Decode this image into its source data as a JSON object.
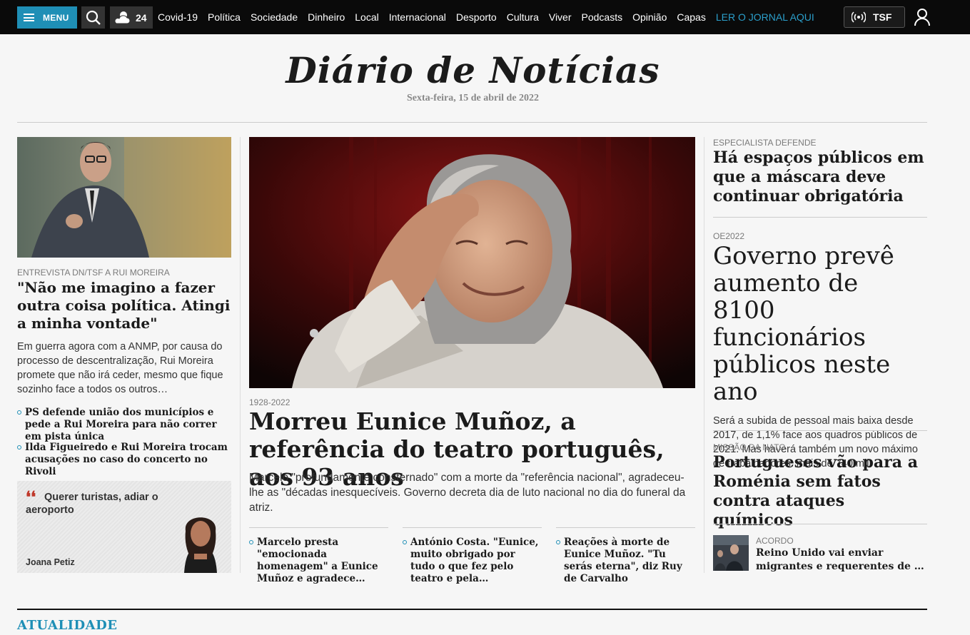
{
  "topbar": {
    "menu_label": "MENU",
    "weather_temp": "24",
    "nav": [
      "Covid-19",
      "Política",
      "Sociedade",
      "Dinheiro",
      "Local",
      "Internacional",
      "Desporto",
      "Cultura",
      "Viver",
      "Podcasts",
      "Opinião",
      "Capas"
    ],
    "read_paper": "LER O JORNAL AQUI",
    "radio_label": "TSF",
    "accent_color": "#1f8fb6"
  },
  "masthead": {
    "logo": "Diário de Notícias",
    "date": "Sexta-feira, 15 de abril de 2022"
  },
  "left": {
    "kicker": "ENTREVISTA DN/TSF A RUI MOREIRA",
    "title": "\"Não me imagino a fazer outra coisa política. Atingi a minha vontade\"",
    "lead": "Em guerra agora com a ANMP, por causa do processo de descentralização, Rui Moreira promete que não irá ceder, mesmo que fique sozinho face a todos os outros…",
    "links": [
      "PS defende união dos municípios e pede a Rui Moreira para não correr em pista única",
      "Ilda Figueiredo e Rui Moreira trocam acusações no caso do concerto no Rivoli"
    ],
    "opinion": {
      "title": "Querer turistas, adiar o aeroporto",
      "author": "Joana Petiz"
    }
  },
  "center": {
    "kicker": "1928-2022",
    "title": "Morreu Eunice Muñoz, a referência do teatro português, aos 93 anos",
    "lead": "Marcelo \"profundamente consternado\" com a morte da \"referência nacional\", agradeceu-lhe as \"décadas inesquecíveis. Governo decreta dia de luto nacional no dia do funeral da atriz.",
    "related": [
      "Marcelo presta \"emocionada homenagem\" a Eunice Muñoz e agradece…",
      "António Costa. \"Eunice, muito obrigado por tudo o que fez pelo teatro e pela…",
      "Reações à morte de Eunice Muñoz. \"Tu serás eterna\", diz Ruy de Carvalho"
    ]
  },
  "right": {
    "s1_kicker": "ESPECIALISTA DEFENDE",
    "s1_title": "Há espaços públicos em que a máscara deve continuar obrigatória",
    "s2_kicker": "OE2022",
    "s2_title": "Governo prevê aumento de 8100 funcionários públicos neste ano",
    "s2_lead": "Será a subida de pessoal mais baixa desde 2017, de 1,1% face aos quadros públicos de 2021. Mas haverá também um novo máximo de trabalhadores: mais de 740 mil.",
    "s3_kicker": "MISSÃO DA NATO",
    "s3_title": "Portugueses vão para a Roménia sem fatos contra ataques químicos",
    "s4_kicker": "ACORDO",
    "s4_title_line1": "Reino Unido vai enviar",
    "s4_title_line2": "migrantes e requerentes de asi…"
  },
  "section": {
    "title": "ATUALIDADE"
  }
}
